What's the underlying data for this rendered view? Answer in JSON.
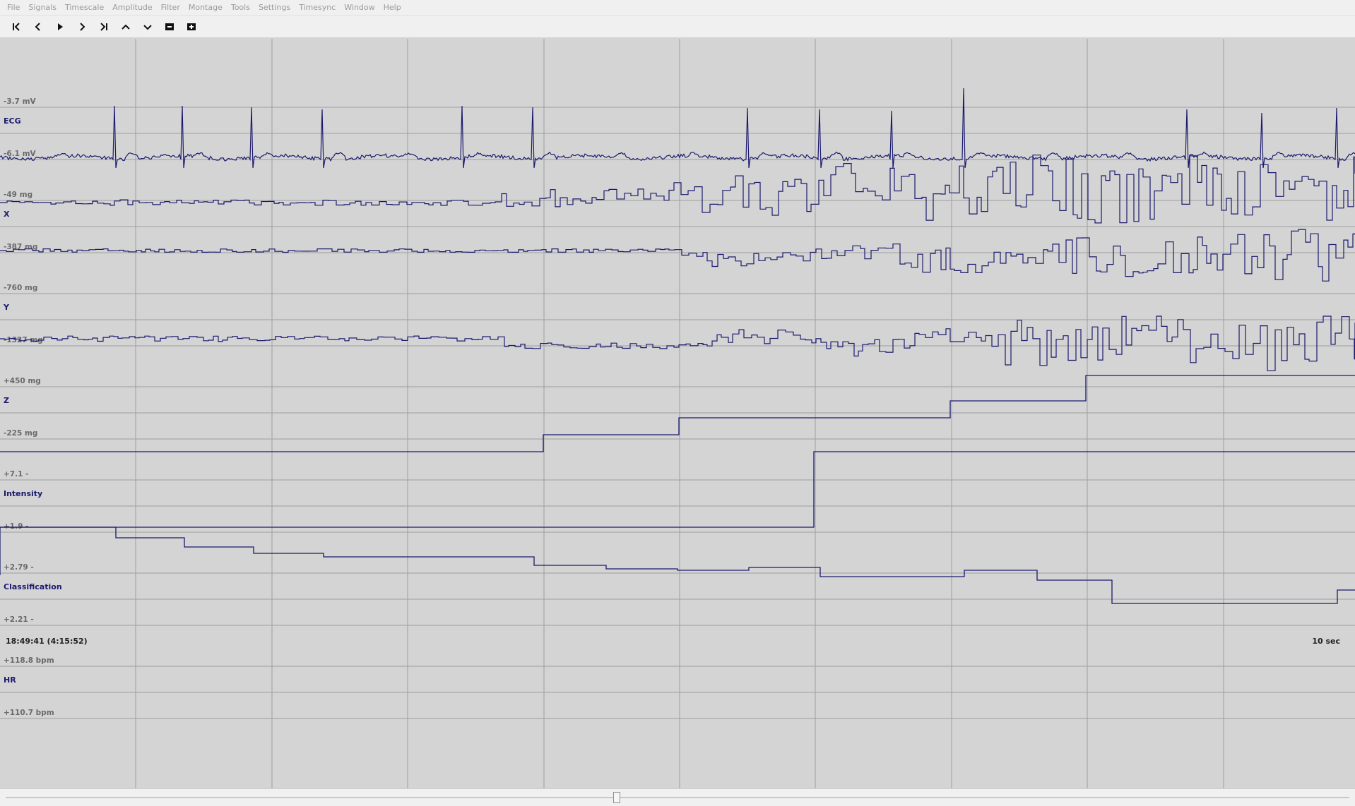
{
  "menu": [
    "File",
    "Signals",
    "Timescale",
    "Amplitude",
    "Filter",
    "Montage",
    "Tools",
    "Settings",
    "Timesync",
    "Window",
    "Help"
  ],
  "toolbar": [
    {
      "name": "first-page-button",
      "icon": "skip-to-start-icon"
    },
    {
      "name": "prev-page-button",
      "icon": "chevron-left-icon"
    },
    {
      "name": "play-button",
      "icon": "play-icon"
    },
    {
      "name": "next-page-button",
      "icon": "chevron-right-icon"
    },
    {
      "name": "last-page-button",
      "icon": "skip-to-end-icon"
    },
    {
      "name": "shift-up-button",
      "icon": "chevron-up-icon"
    },
    {
      "name": "shift-down-button",
      "icon": "chevron-down-icon"
    },
    {
      "name": "zoom-out-button",
      "icon": "minus-box-icon"
    },
    {
      "name": "zoom-in-button",
      "icon": "plus-box-icon"
    }
  ],
  "channels": [
    {
      "name": "ECG",
      "top_label": "-3.7 mV",
      "bottom_label": "-6.1 mV"
    },
    {
      "name": "X",
      "top_label": "-49 mg",
      "bottom_label": "-387 mg"
    },
    {
      "name": "Y",
      "top_label": "-760 mg",
      "bottom_label": "-1327 mg"
    },
    {
      "name": "Z",
      "top_label": "+450 mg",
      "bottom_label": "-225 mg"
    },
    {
      "name": "Intensity",
      "top_label": "+7.1 -",
      "bottom_label": "+1.9 -"
    },
    {
      "name": "Classification",
      "top_label": "+2.79 -",
      "bottom_label": "+2.21 -"
    },
    {
      "name": "HR",
      "top_label": "+118.8 bpm",
      "bottom_label": "+110.7 bpm"
    }
  ],
  "footer": {
    "timestamp": "18:49:41 (4:15:52)",
    "timescale": "10 sec"
  },
  "scroll_position": 0.455,
  "colors": {
    "trace": "#1a1a6e",
    "grid": "#9e9e9e",
    "background": "#d4d4d4"
  }
}
